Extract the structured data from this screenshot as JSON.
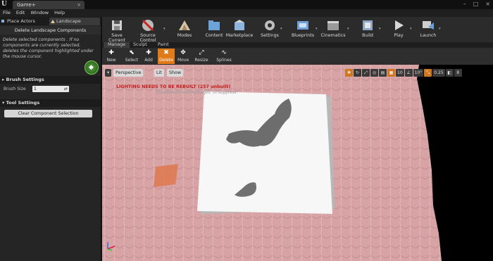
{
  "window": {
    "tab_title": "Game+",
    "tab_close": "×",
    "controls": [
      "–",
      "□",
      "×"
    ]
  },
  "menu": [
    "File",
    "Edit",
    "Window",
    "Help"
  ],
  "modes": {
    "place_actors": "Place Actors",
    "landscape": "Landscape"
  },
  "tool": {
    "header": "Delete Landscape Components",
    "description": "Delete selected components . If no components are currently selected, deletes the component highlighted under the mouse cursor."
  },
  "brush_settings": {
    "title": "Brush Settings",
    "brush_size_label": "Brush Size",
    "brush_size_value": "1"
  },
  "tool_settings": {
    "title": "Tool Settings",
    "clear_button": "Clear Component Selection"
  },
  "toolbar": {
    "save_current": "Save Current",
    "source_control": "Source Control",
    "modes": "Modes",
    "content": "Content",
    "marketplace": "Marketplace",
    "settings": "Settings",
    "blueprints": "Blueprints",
    "cinematics": "Cinematics",
    "build": "Build",
    "play": "Play",
    "launch": "Launch"
  },
  "landscape_tabs": [
    "Manage",
    "Sculpt",
    "Paint"
  ],
  "landscape_tools": {
    "new": "New",
    "select": "Select",
    "add": "Add",
    "delete": "Delete",
    "move": "Move",
    "resize": "Resize",
    "splines": "Splines"
  },
  "viewport": {
    "perspective": "Perspective",
    "lit": "Lit",
    "show": "Show",
    "lighting_warning": "LIGHTING NEEDS TO BE REBUILT (257 unbuilt)",
    "lighting_sub": "'DisableAllScreenMessages' to suppress",
    "grid_snap": "10",
    "rot_snap": "10°",
    "scale_snap": "0.25",
    "camera_speed": "8"
  },
  "colors": {
    "accent_orange": "#e07b1a",
    "warning_red": "#c41c1c",
    "terrain_pink": "#d9a7a8"
  }
}
